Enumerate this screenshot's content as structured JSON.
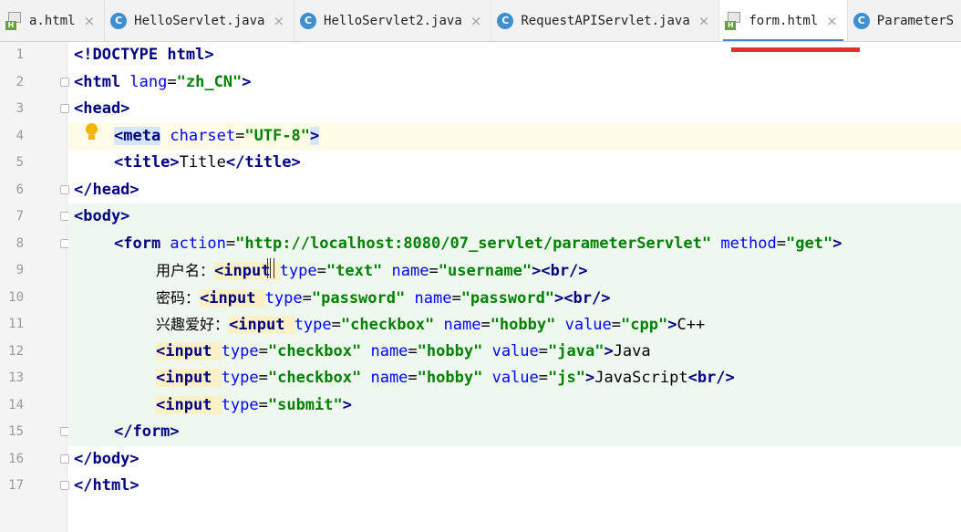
{
  "tabs": [
    {
      "label": "a.html",
      "type": "html",
      "active": false
    },
    {
      "label": "HelloServlet.java",
      "type": "java",
      "active": false
    },
    {
      "label": "HelloServlet2.java",
      "type": "java",
      "active": false
    },
    {
      "label": "RequestAPIServlet.java",
      "type": "java",
      "active": false
    },
    {
      "label": "form.html",
      "type": "html",
      "active": true
    },
    {
      "label": "ParameterS",
      "type": "java",
      "active": false
    }
  ],
  "icons": {
    "html": "html-file-icon",
    "java": "java-class-icon",
    "close": "close-icon",
    "hint": "lightbulb-icon"
  },
  "colors": {
    "tag": "#000080",
    "attr": "#0000ff",
    "value": "#008000",
    "annotation": "#e03030",
    "active_tab_underline": "#4a86c8"
  },
  "line_numbers": [
    "1",
    "2",
    "3",
    "4",
    "5",
    "6",
    "7",
    "8",
    "9",
    "10",
    "11",
    "12",
    "13",
    "14",
    "15",
    "16",
    "17"
  ],
  "code": {
    "l1": {
      "a": "<!DOCTYPE ",
      "b": "html",
      "c": ">"
    },
    "l2": {
      "a": "<html ",
      "b": "lang",
      "c": "=",
      "d": "\"zh_CN\"",
      "e": ">"
    },
    "l3": {
      "a": "<head>"
    },
    "l4": {
      "a": "<meta",
      "b": " charset",
      "c": "=",
      "d": "\"UTF-8\"",
      "e": ">"
    },
    "l5": {
      "a": "<title>",
      "b": "Title",
      "c": "</title>"
    },
    "l6": {
      "a": "</head>"
    },
    "l7": {
      "a": "<body>"
    },
    "l8": {
      "a": "<form ",
      "b": "action",
      "c": "=",
      "d": "\"http://localhost:8080/07_servlet/parameterServlet\"",
      "e": " ",
      "f": "method",
      "g": "=",
      "h": "\"get\"",
      "i": ">"
    },
    "l9": {
      "cn": "用户名：",
      "a": "<input ",
      "b": "type",
      "c": "=",
      "d": "\"text\"",
      "e": " ",
      "f": "name",
      "g": "=",
      "h": "\"username\"",
      "i": "><br/>"
    },
    "l10": {
      "cn": "密码：",
      "a": "<input ",
      "b": "type",
      "c": "=",
      "d": "\"password\"",
      "e": " ",
      "f": "name",
      "g": "=",
      "h": "\"password\"",
      "i": "><br/>"
    },
    "l11": {
      "cn": "兴趣爱好：",
      "a": "<input ",
      "b": "type",
      "c": "=",
      "d": "\"checkbox\"",
      "e": " ",
      "f": "name",
      "g": "=",
      "h": "\"hobby\"",
      "j": " ",
      "k": "value",
      "l": "=",
      "m": "\"cpp\"",
      "i": ">",
      "t": "C++"
    },
    "l12": {
      "a": "<input ",
      "b": "type",
      "c": "=",
      "d": "\"checkbox\"",
      "e": " ",
      "f": "name",
      "g": "=",
      "h": "\"hobby\"",
      "j": " ",
      "k": "value",
      "l": "=",
      "m": "\"java\"",
      "i": ">",
      "t": "Java"
    },
    "l13": {
      "a": "<input ",
      "b": "type",
      "c": "=",
      "d": "\"checkbox\"",
      "e": " ",
      "f": "name",
      "g": "=",
      "h": "\"hobby\"",
      "j": " ",
      "k": "value",
      "l": "=",
      "m": "\"js\"",
      "i": ">",
      "t": "JavaScript",
      "n": "<br/>"
    },
    "l14": {
      "a": "<input ",
      "b": "type",
      "c": "=",
      "d": "\"submit\"",
      "i": ">"
    },
    "l15": {
      "a": "</form>"
    },
    "l16": {
      "a": "</body>"
    },
    "l17": {
      "a": "</html>"
    }
  }
}
